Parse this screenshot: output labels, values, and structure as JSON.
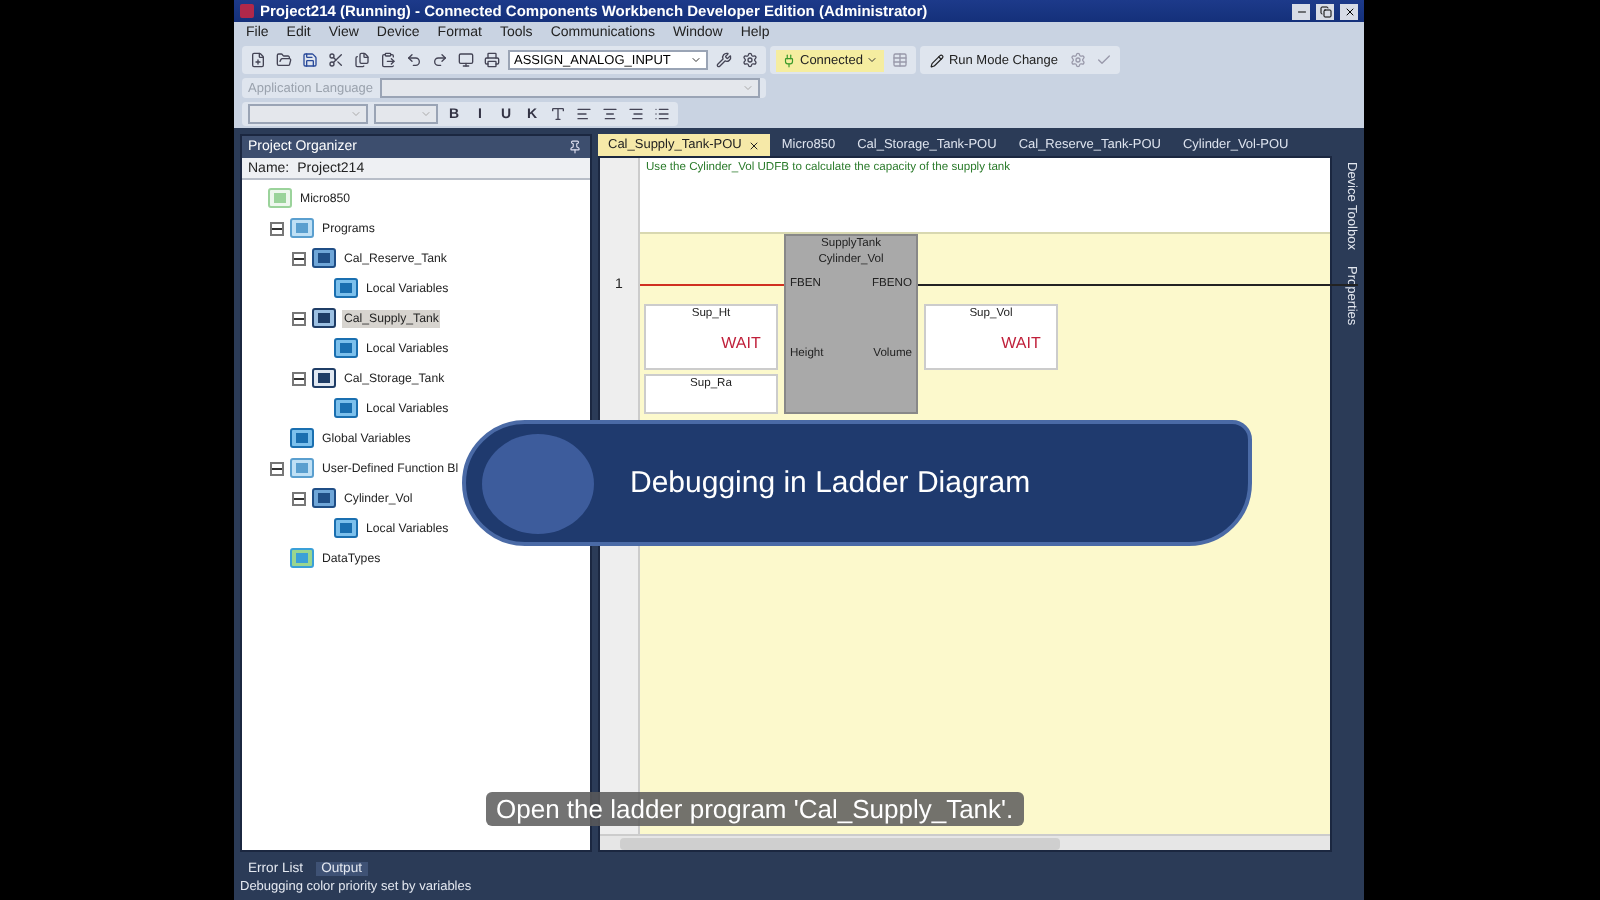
{
  "window": {
    "title": "Project214 (Running) - Connected Components Workbench Developer Edition (Administrator)"
  },
  "menu": [
    "File",
    "Edit",
    "View",
    "Device",
    "Format",
    "Tools",
    "Communications",
    "Window",
    "Help"
  ],
  "toolbar": {
    "program_select": "ASSIGN_ANALOG_INPUT",
    "connection": {
      "label": "Connected",
      "connected": true
    },
    "run_mode": "Run Mode Change",
    "language": {
      "label": "Application Language",
      "disabled": true
    },
    "format_buttons": [
      "B",
      "I",
      "U",
      "K"
    ]
  },
  "project_organizer": {
    "title": "Project Organizer",
    "name_label": "Name:",
    "name_value": "Project214",
    "tree": [
      {
        "label": "Micro850",
        "kind": "controller",
        "selected": false,
        "children": [
          {
            "label": "Programs",
            "kind": "folder",
            "selected": false,
            "expanded": true,
            "children": [
              {
                "label": "Cal_Reserve_Tank",
                "kind": "program",
                "selected": false,
                "expanded": true,
                "children": [
                  {
                    "label": "Local Variables",
                    "kind": "variables",
                    "selected": false
                  }
                ]
              },
              {
                "label": "Cal_Supply_Tank",
                "kind": "ladder",
                "selected": true,
                "expanded": true,
                "children": [
                  {
                    "label": "Local Variables",
                    "kind": "variables",
                    "selected": false
                  }
                ]
              },
              {
                "label": "Cal_Storage_Tank",
                "kind": "sfc",
                "selected": false,
                "expanded": true,
                "children": [
                  {
                    "label": "Local Variables",
                    "kind": "variables",
                    "selected": false
                  }
                ]
              }
            ]
          },
          {
            "label": "Global Variables",
            "kind": "variables",
            "selected": false
          },
          {
            "label": "User-Defined Function Bl",
            "kind": "folder",
            "selected": false,
            "expanded": true,
            "children": [
              {
                "label": "Cylinder_Vol",
                "kind": "program",
                "selected": false,
                "expanded": true,
                "children": [
                  {
                    "label": "Local Variables",
                    "kind": "variables",
                    "selected": false
                  }
                ]
              }
            ]
          },
          {
            "label": "DataTypes",
            "kind": "datatypes",
            "selected": false
          }
        ]
      }
    ]
  },
  "editor": {
    "tabs": [
      {
        "label": "Cal_Supply_Tank-POU",
        "selected": true
      },
      {
        "label": "Micro850",
        "selected": false
      },
      {
        "label": "Cal_Storage_Tank-POU",
        "selected": false
      },
      {
        "label": "Cal_Reserve_Tank-POU",
        "selected": false
      },
      {
        "label": "Cylinder_Vol-POU",
        "selected": false
      }
    ],
    "comment": "Use the Cylinder_Vol UDFB to calculate the capacity of the supply tank",
    "rung": {
      "number": "1",
      "powered": true
    },
    "block": {
      "instance": "SupplyTank",
      "type": "Cylinder_Vol",
      "inputs": [
        "FBEN",
        "Height"
      ],
      "outputs": [
        "FBENO",
        "Volume"
      ]
    },
    "variables": [
      {
        "name": "Sup_Ht",
        "value": "WAIT",
        "kind": "input"
      },
      {
        "name": "Sup_Ra",
        "kind": "input"
      },
      {
        "name": "Sup_Vol",
        "value": "WAIT",
        "kind": "output"
      }
    ]
  },
  "side_tabs": [
    "Device Toolbox",
    "Properties"
  ],
  "bottom_tabs": [
    "Error List",
    "Output"
  ],
  "status_bar": "Debugging color priority set by variables",
  "overlay": {
    "banner": "Debugging in Ladder Diagram",
    "caption": "Open the ladder program 'Cal_Supply_Tank'."
  }
}
